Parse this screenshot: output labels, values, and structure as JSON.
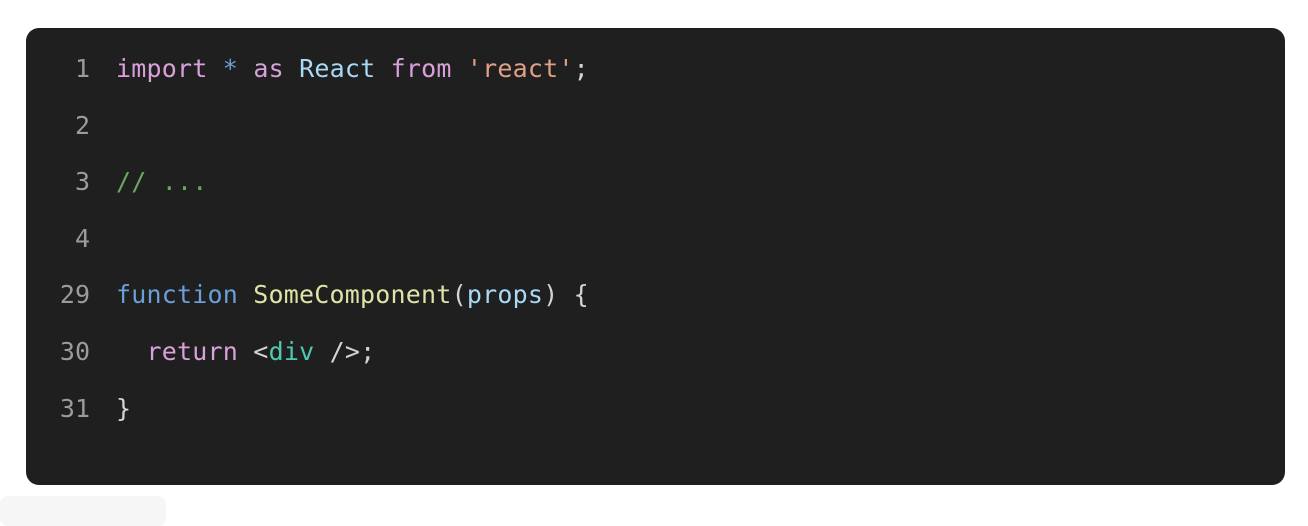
{
  "code_block": {
    "language": "jsx",
    "background_color": "#1f1f1f",
    "gutter_color": "#9b9b9b",
    "lines": [
      {
        "number": "1",
        "tokens": [
          {
            "text": "import",
            "type": "keyword"
          },
          {
            "text": " ",
            "type": "punct"
          },
          {
            "text": "*",
            "type": "operator"
          },
          {
            "text": " ",
            "type": "punct"
          },
          {
            "text": "as",
            "type": "keyword"
          },
          {
            "text": " ",
            "type": "punct"
          },
          {
            "text": "React",
            "type": "variable"
          },
          {
            "text": " ",
            "type": "punct"
          },
          {
            "text": "from",
            "type": "keyword"
          },
          {
            "text": " ",
            "type": "punct"
          },
          {
            "text": "'react'",
            "type": "string"
          },
          {
            "text": ";",
            "type": "punct"
          }
        ],
        "plain": "import * as React from 'react';"
      },
      {
        "number": "2",
        "tokens": [],
        "plain": ""
      },
      {
        "number": "3",
        "tokens": [
          {
            "text": "// ...",
            "type": "comment"
          }
        ],
        "plain": "// ..."
      },
      {
        "number": "4",
        "tokens": [],
        "plain": ""
      },
      {
        "number": "29",
        "tokens": [
          {
            "text": "function",
            "type": "storage"
          },
          {
            "text": " ",
            "type": "punct"
          },
          {
            "text": "SomeComponent",
            "type": "funcname"
          },
          {
            "text": "(",
            "type": "punct"
          },
          {
            "text": "props",
            "type": "variable"
          },
          {
            "text": ")",
            "type": "punct"
          },
          {
            "text": " {",
            "type": "punct"
          }
        ],
        "plain": "function SomeComponent(props) {"
      },
      {
        "number": "30",
        "tokens": [
          {
            "text": "  ",
            "type": "punct"
          },
          {
            "text": "return",
            "type": "keyword"
          },
          {
            "text": " ",
            "type": "punct"
          },
          {
            "text": "<",
            "type": "punct"
          },
          {
            "text": "div",
            "type": "tag"
          },
          {
            "text": " />;",
            "type": "punct"
          }
        ],
        "plain": "  return <div />;"
      },
      {
        "number": "31",
        "tokens": [
          {
            "text": "}",
            "type": "punct"
          }
        ],
        "plain": "}"
      }
    ]
  },
  "colors": {
    "page_background": "#ffffff",
    "code_background": "#1f1f1f",
    "keyword": "#d9a0d9",
    "operator": "#6b9fd8",
    "variable": "#a8d9f5",
    "string": "#e0a083",
    "punctuation": "#d4d4d4",
    "comment": "#6aa661",
    "storage": "#6b9fd8",
    "function_name": "#e2e2a8",
    "tag": "#4ec9b0",
    "line_number": "#9b9b9b",
    "caption_strip": "#f6f6f7"
  }
}
